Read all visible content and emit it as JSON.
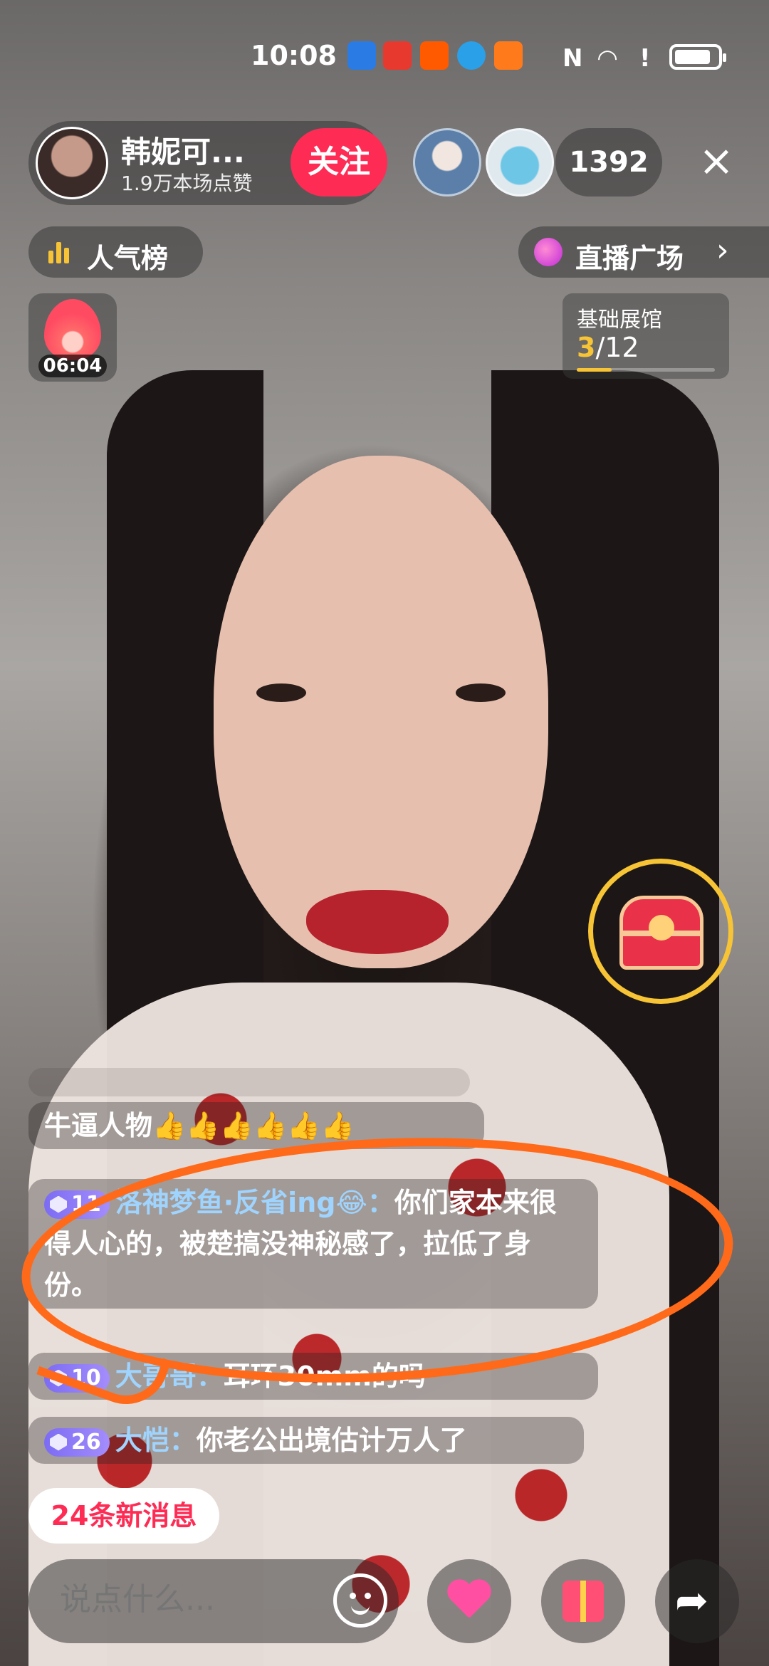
{
  "status_bar": {
    "time": "10:08",
    "app_icons": [
      "shield-icon",
      "huawei-store-icon",
      "taobao-icon",
      "browser-icon",
      "video-icon"
    ],
    "nfc": "N",
    "battery_level": 0.85
  },
  "host": {
    "name": "韩妮可...",
    "likes": "1.9万本场点赞",
    "follow_label": "关注"
  },
  "viewer_count": "1392",
  "close_icon": "×",
  "rank": {
    "label": "人气榜"
  },
  "plaza": {
    "label": "直播广场",
    "chevron": "›"
  },
  "fire_timer": "06:04",
  "museum": {
    "title": "基础展馆",
    "current": "3",
    "total": "/12",
    "progress": 0.25
  },
  "chat": [
    {
      "user": "",
      "text": "牛逼人物👍👍👍👍👍👍",
      "level": ""
    },
    {
      "level": "11",
      "user": "洛神梦鱼·反省ing😂：",
      "text": "你们家本来很得人心的，被楚搞没神秘感了，拉低了身份。"
    },
    {
      "level": "10",
      "user": "大哥哥：",
      "text": "耳环30mm的吗"
    },
    {
      "level": "26",
      "user": "大恺：",
      "text": "你老公出境估计万人了"
    }
  ],
  "new_messages": "24条新消息",
  "input": {
    "placeholder": "说点什么..."
  },
  "colors": {
    "follow": "#fe2c55",
    "accent_yellow": "#f7c435",
    "username": "#9fd4ff",
    "annotation": "#ff6a1a"
  }
}
